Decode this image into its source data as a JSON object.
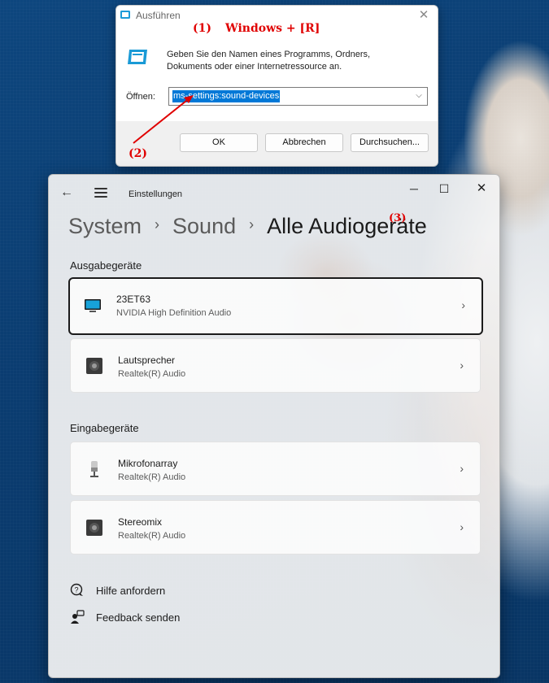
{
  "run_dialog": {
    "title": "Ausführen",
    "description": "Geben Sie den Namen eines Programms, Ordners, Dokuments oder einer Internetressource an.",
    "open_label": "Öffnen:",
    "input_value": "ms-settings:sound-devices",
    "buttons": {
      "ok": "OK",
      "cancel": "Abbrechen",
      "browse": "Durchsuchen..."
    }
  },
  "annotations": {
    "step1": "(1)",
    "step1_text": "Windows + [R]",
    "step2": "(2)",
    "step3": "(3)"
  },
  "settings": {
    "app_title": "Einstellungen",
    "breadcrumb": [
      "System",
      "Sound",
      "Alle Audiogeräte"
    ],
    "output_header": "Ausgabegeräte",
    "input_header": "Eingabegeräte",
    "output_devices": [
      {
        "name": "23ET63",
        "driver": "NVIDIA High Definition Audio",
        "icon": "monitor-icon"
      },
      {
        "name": "Lautsprecher",
        "driver": "Realtek(R) Audio",
        "icon": "speaker-icon"
      }
    ],
    "input_devices": [
      {
        "name": "Mikrofonarray",
        "driver": "Realtek(R) Audio",
        "icon": "microphone-icon"
      },
      {
        "name": "Stereomix",
        "driver": "Realtek(R) Audio",
        "icon": "speaker-icon"
      }
    ],
    "links": {
      "help": "Hilfe anfordern",
      "feedback": "Feedback senden"
    }
  },
  "colors": {
    "annotation": "#e00000",
    "selection": "#0078d7",
    "desktop": "#0b3f73"
  }
}
